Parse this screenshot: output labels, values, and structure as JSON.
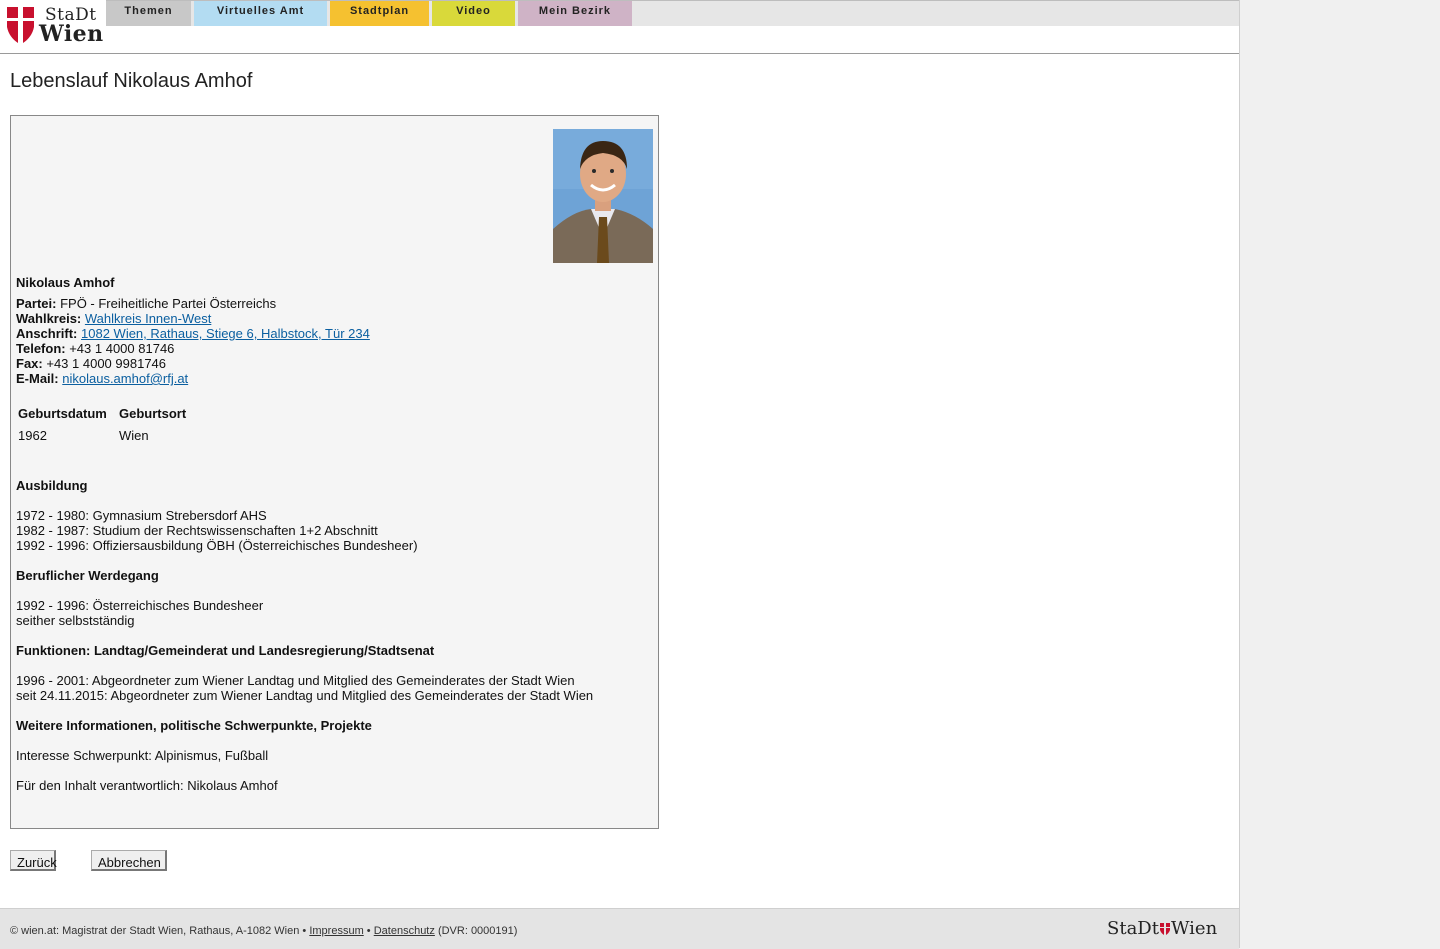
{
  "brand": {
    "line1": "StaDt",
    "line2": "Wien"
  },
  "nav": {
    "themen": "Themen",
    "amt": "Virtuelles Amt",
    "plan": "Stadtplan",
    "video": "Video",
    "bezirk": "Mein Bezirk"
  },
  "page_title": "Lebenslauf Nikolaus Amhof",
  "profile": {
    "name": "Nikolaus Amhof",
    "partei_label": "Partei:",
    "partei": "FPÖ - Freiheitliche Partei Österreichs",
    "wahlkreis_label": "Wahlkreis:",
    "wahlkreis": "Wahlkreis Innen-West",
    "anschrift_label": "Anschrift:",
    "anschrift": "1082 Wien, Rathaus, Stiege 6, Halbstock, Tür 234",
    "telefon_label": "Telefon:",
    "telefon": "+43 1 4000 81746",
    "fax_label": "Fax:",
    "fax": "+43 1 4000 9981746",
    "email_label": "E-Mail:",
    "email": "nikolaus.amhof@rfj.at"
  },
  "birth_table": {
    "headers": [
      "Geburtsdatum",
      "Geburtsort"
    ],
    "row": [
      "1962",
      "Wien"
    ]
  },
  "sections": {
    "ausbildung_title": "Ausbildung",
    "ausbildung": [
      "1972 - 1980: Gymnasium Strebersdorf AHS",
      "1982 - 1987: Studium der Rechtswissenschaften 1+2 Abschnitt",
      "1992 - 1996: Offiziersausbildung ÖBH (Österreichisches Bundesheer)"
    ],
    "beruf_title": "Beruflicher Werdegang",
    "beruf": [
      "1992 - 1996: Österreichisches Bundesheer",
      "seither selbstständig"
    ],
    "funktionen_title": "Funktionen: Landtag/Gemeinderat und Landesregierung/Stadtsenat",
    "funktionen": [
      "1996 - 2001: Abgeordneter zum Wiener Landtag und Mitglied des Gemeinderates der Stadt Wien",
      "seit 24.11.2015: Abgeordneter zum Wiener Landtag und Mitglied des Gemeinderates der Stadt Wien"
    ],
    "weitere_title": "Weitere Informationen, politische Schwerpunkte, Projekte",
    "interesse": "Interesse Schwerpunkt: Alpinismus, Fußball",
    "verantwortlich": "Für den Inhalt verantwortlich: Nikolaus Amhof"
  },
  "buttons": {
    "back": "Zurück",
    "cancel": "Abbrechen"
  },
  "footer": {
    "copyright": "© wien.at: Magistrat der Stadt Wien, Rathaus, A-1082 Wien •",
    "impressum": "Impressum",
    "sep": "•",
    "datenschutz": "Datenschutz",
    "dvr": "(DVR: 0000191)",
    "logo_left": "StaDt",
    "logo_right": "Wien"
  },
  "colors": {
    "link": "#0b5fa0",
    "brand_red": "#c8102e",
    "tab_amt": "#b3dcf2",
    "tab_plan": "#f5c130",
    "tab_video": "#d9d93a",
    "tab_bezirk": "#cfb3c6"
  },
  "icons": {
    "logo": "wien-shield-icon",
    "portrait": "portrait-photo"
  }
}
